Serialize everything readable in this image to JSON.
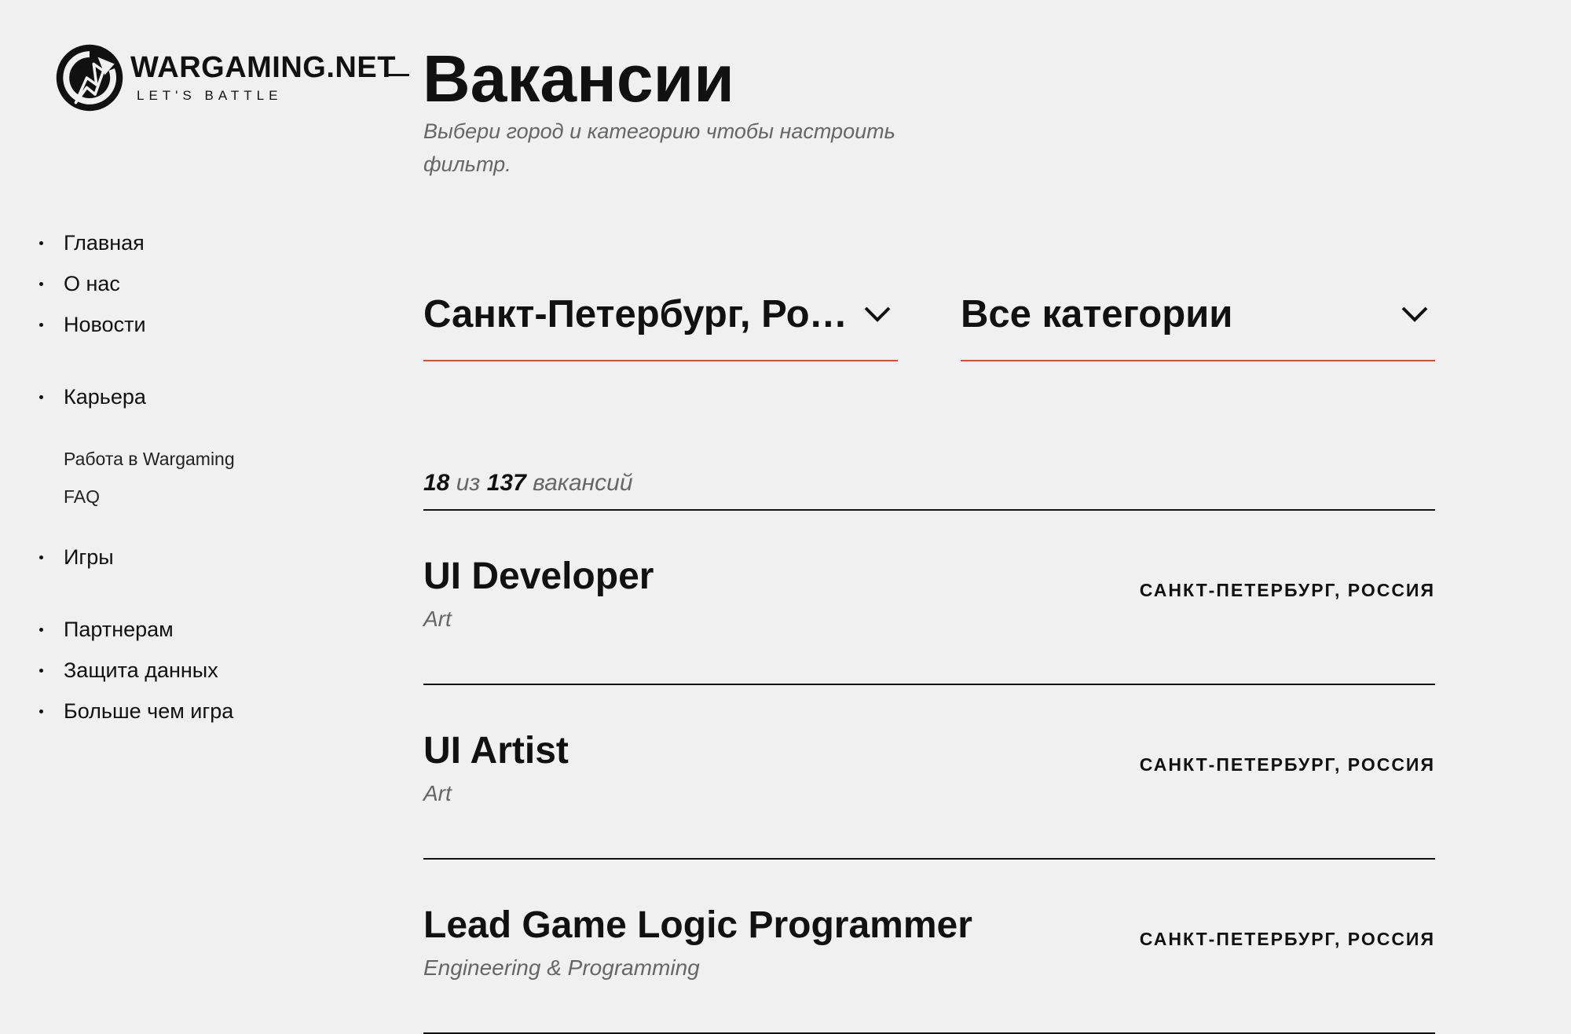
{
  "logo": {
    "brand": "WARGAMING.NET",
    "tagline": "LET'S BATTLE"
  },
  "header": {
    "title": "Вакансии",
    "subtitle": "Выбери город и категорию чтобы настроить фильтр."
  },
  "sidebar": {
    "items": [
      {
        "label": "Главная"
      },
      {
        "label": "О нас"
      },
      {
        "label": "Новости"
      },
      {
        "label": "Карьера"
      },
      {
        "label": "Игры"
      },
      {
        "label": "Партнерам"
      },
      {
        "label": "Защита данных"
      },
      {
        "label": "Больше чем игра"
      }
    ],
    "career_sub": [
      {
        "label": "Работа в Wargaming"
      },
      {
        "label": "FAQ"
      }
    ]
  },
  "filters": {
    "city": {
      "value": "Санкт-Петербург, Россия",
      "icon": "chevron-down-icon"
    },
    "category": {
      "value": "Все категории",
      "icon": "chevron-down-icon"
    }
  },
  "results": {
    "shown": "18",
    "of": "из",
    "total": "137",
    "unit": "вакансий"
  },
  "vacancies": [
    {
      "title": "UI Developer",
      "category": "Art",
      "location": "САНКТ-ПЕТЕРБУРГ, РОССИЯ"
    },
    {
      "title": "UI Artist",
      "category": "Art",
      "location": "САНКТ-ПЕТЕРБУРГ, РОССИЯ"
    },
    {
      "title": "Lead Game Logic Programmer",
      "category": "Engineering & Programming",
      "location": "САНКТ-ПЕТЕРБУРГ, РОССИЯ"
    }
  ],
  "colors": {
    "background": "#f0f0f0",
    "text": "#111111",
    "muted": "#666666",
    "accent_underline": "#d8493a"
  }
}
